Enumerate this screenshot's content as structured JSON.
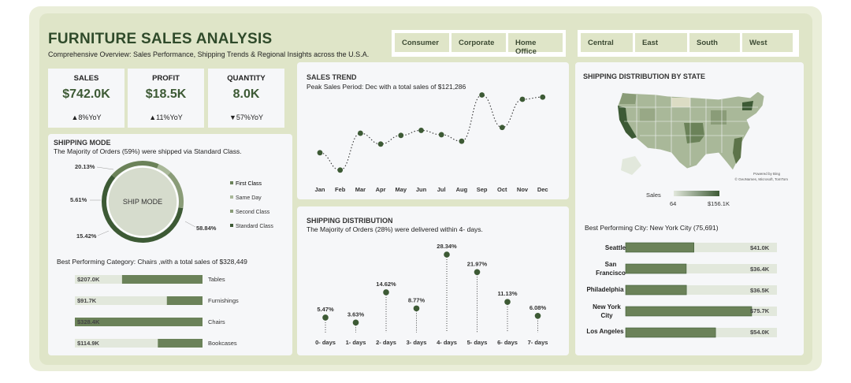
{
  "header": {
    "title": "FURNITURE SALES ANALYSIS",
    "subtitle": "Comprehensive Overview: Sales Performance, Shipping Trends & Regional Insights across the U.S.A."
  },
  "segments": [
    "Consumer",
    "Corporate",
    "Home Office"
  ],
  "regions": [
    "Central",
    "East",
    "South",
    "West"
  ],
  "kpis": [
    {
      "label": "SALES",
      "value": "$742.0K",
      "yoy": "▲8%YoY"
    },
    {
      "label": "PROFIT",
      "value": "$18.5K",
      "yoy": "▲11%YoY"
    },
    {
      "label": "QUANTITY",
      "value": "8.0K",
      "yoy": "▼57%YoY"
    }
  ],
  "shipping_mode": {
    "title": "SHIPPING MODE",
    "desc": "The Majority of Orders (59%) were shipped via Standard Class.",
    "center": "SHIP MODE",
    "labels": [
      "20.13%",
      "5.61%",
      "15.42%",
      "58.84%"
    ],
    "legend": [
      "First Class",
      "Same Day",
      "Second Class",
      "Standard Class"
    ]
  },
  "category": {
    "desc": "Best Performing Category: Chairs ,with a total sales of $328,449",
    "items": [
      {
        "value_label": "$207.0K",
        "name": "Tables"
      },
      {
        "value_label": "$91.7K",
        "name": "Furnishings"
      },
      {
        "value_label": "$328.4K",
        "name": "Chairs"
      },
      {
        "value_label": "$114.9K",
        "name": "Bookcases"
      }
    ]
  },
  "sales_trend": {
    "title": "SALES TREND",
    "desc": "Peak Sales Period: Dec with a total sales of $121,286"
  },
  "shipping_distribution": {
    "title": "SHIPPING DISTRIBUTION",
    "desc": "The Majority of Orders (28%) were delivered within 4- days."
  },
  "state": {
    "title": "SHIPPING DISTRIBUTION BY STATE",
    "attribution1": "Powered by Bing",
    "attribution2": "© GeoNames, Microsoft, TomTom",
    "legend_title": "Sales",
    "legend_min": "64",
    "legend_max": "$156.1K"
  },
  "city": {
    "desc": "Best Performing City: New York City (75,691)",
    "items": [
      {
        "name": "Seattle",
        "value_label": "$41.0K"
      },
      {
        "name": "San Francisco",
        "value_label": "$36.4K"
      },
      {
        "name": "Philadelphia",
        "value_label": "$36.5K"
      },
      {
        "name": "New York City",
        "value_label": "$75.7K"
      },
      {
        "name": "Los Angeles",
        "value_label": "$54.0K"
      }
    ]
  },
  "colors": {
    "dark": "#3d5a35",
    "mid": "#6b8259",
    "light": "#a9b899",
    "track": "#e2e8dc"
  },
  "chart_data": [
    {
      "type": "pie",
      "title": "SHIPPING MODE",
      "categories": [
        "Standard Class",
        "First Class",
        "Same Day",
        "Second Class"
      ],
      "values": [
        58.84,
        20.13,
        5.61,
        15.42
      ]
    },
    {
      "type": "bar",
      "categories": [
        "Tables",
        "Furnishings",
        "Chairs",
        "Bookcases"
      ],
      "values": [
        207.0,
        91.7,
        328.4,
        114.9
      ]
    },
    {
      "type": "line",
      "title": "SALES TREND",
      "categories": [
        "Jan",
        "Feb",
        "Mar",
        "Apr",
        "May",
        "Jun",
        "Jul",
        "Aug",
        "Sep",
        "Oct",
        "Nov",
        "Dec"
      ],
      "values": [
        44,
        20,
        71,
        56,
        68,
        75,
        69,
        60,
        124,
        79,
        118,
        121
      ]
    },
    {
      "type": "scatter",
      "title": "SHIPPING DISTRIBUTION",
      "categories": [
        "0- days",
        "1- days",
        "2- days",
        "3- days",
        "4- days",
        "5- days",
        "6- days",
        "7- days"
      ],
      "values": [
        5.47,
        3.63,
        14.62,
        8.77,
        28.34,
        21.97,
        11.13,
        6.08
      ],
      "labels": [
        "5.47%",
        "3.63%",
        "14.62%",
        "8.77%",
        "28.34%",
        "21.97%",
        "11.13%",
        "6.08%"
      ]
    },
    {
      "type": "bar",
      "categories": [
        "Seattle",
        "San Francisco",
        "Philadelphia",
        "New York City",
        "Los Angeles"
      ],
      "values": [
        41.0,
        36.4,
        36.5,
        75.7,
        54.0
      ]
    }
  ]
}
